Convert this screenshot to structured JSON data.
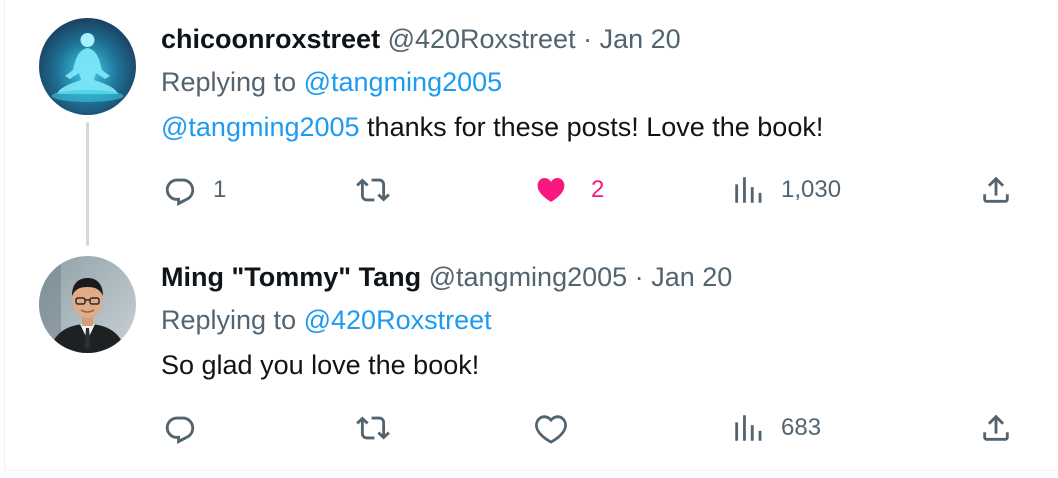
{
  "tweets": [
    {
      "display_name": "chicoonroxstreet",
      "handle": "@420Roxstreet",
      "separator": "·",
      "date": "Jan 20",
      "replying_prefix": "Replying to",
      "replying_to": "@tangming2005",
      "body_mention": "@tangming2005",
      "body_text": " thanks for these posts! Love the book!",
      "reply_count": "1",
      "retweet_count": "",
      "like_count": "2",
      "liked": true,
      "view_count": "1,030",
      "avatar_icon": "meditation-silhouette-avatar"
    },
    {
      "display_name": "Ming \"Tommy\" Tang",
      "handle": "@tangming2005",
      "separator": "·",
      "date": "Jan 20",
      "replying_prefix": "Replying to",
      "replying_to": "@420Roxstreet",
      "body_mention": "",
      "body_text": "So glad you love the book!",
      "reply_count": "",
      "retweet_count": "",
      "like_count": "",
      "liked": false,
      "view_count": "683",
      "avatar_icon": "person-photo-avatar"
    }
  ],
  "colors": {
    "accent": "#1d9bf0",
    "like": "#f91880",
    "muted": "#536471",
    "text": "#0f1419",
    "thread_line": "#cfd9de"
  }
}
